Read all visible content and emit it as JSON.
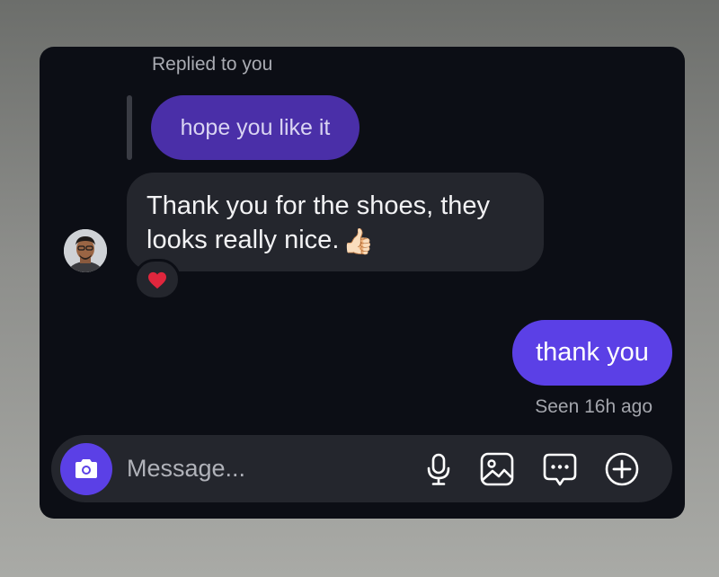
{
  "reply_context": {
    "label": "Replied to you",
    "quoted_message": "hope you like it"
  },
  "received_message": {
    "text": "Thank you for the shoes, they looks really nice.",
    "emoji": "👍🏻",
    "reaction": "❤️",
    "avatar_icon": "person-avatar"
  },
  "sent_message": {
    "text": "thank you",
    "status": "Seen 16h ago"
  },
  "composer": {
    "placeholder": "Message...",
    "icons": [
      "camera-icon",
      "microphone-icon",
      "gallery-icon",
      "sticker-icon",
      "plus-icon"
    ]
  },
  "colors": {
    "sent_bubble": "#5b40e6",
    "reply_bubble": "#4a2fa8",
    "received_bubble": "#24262d",
    "card_background": "#0c0e15",
    "reaction_heart": "#e0263d"
  }
}
